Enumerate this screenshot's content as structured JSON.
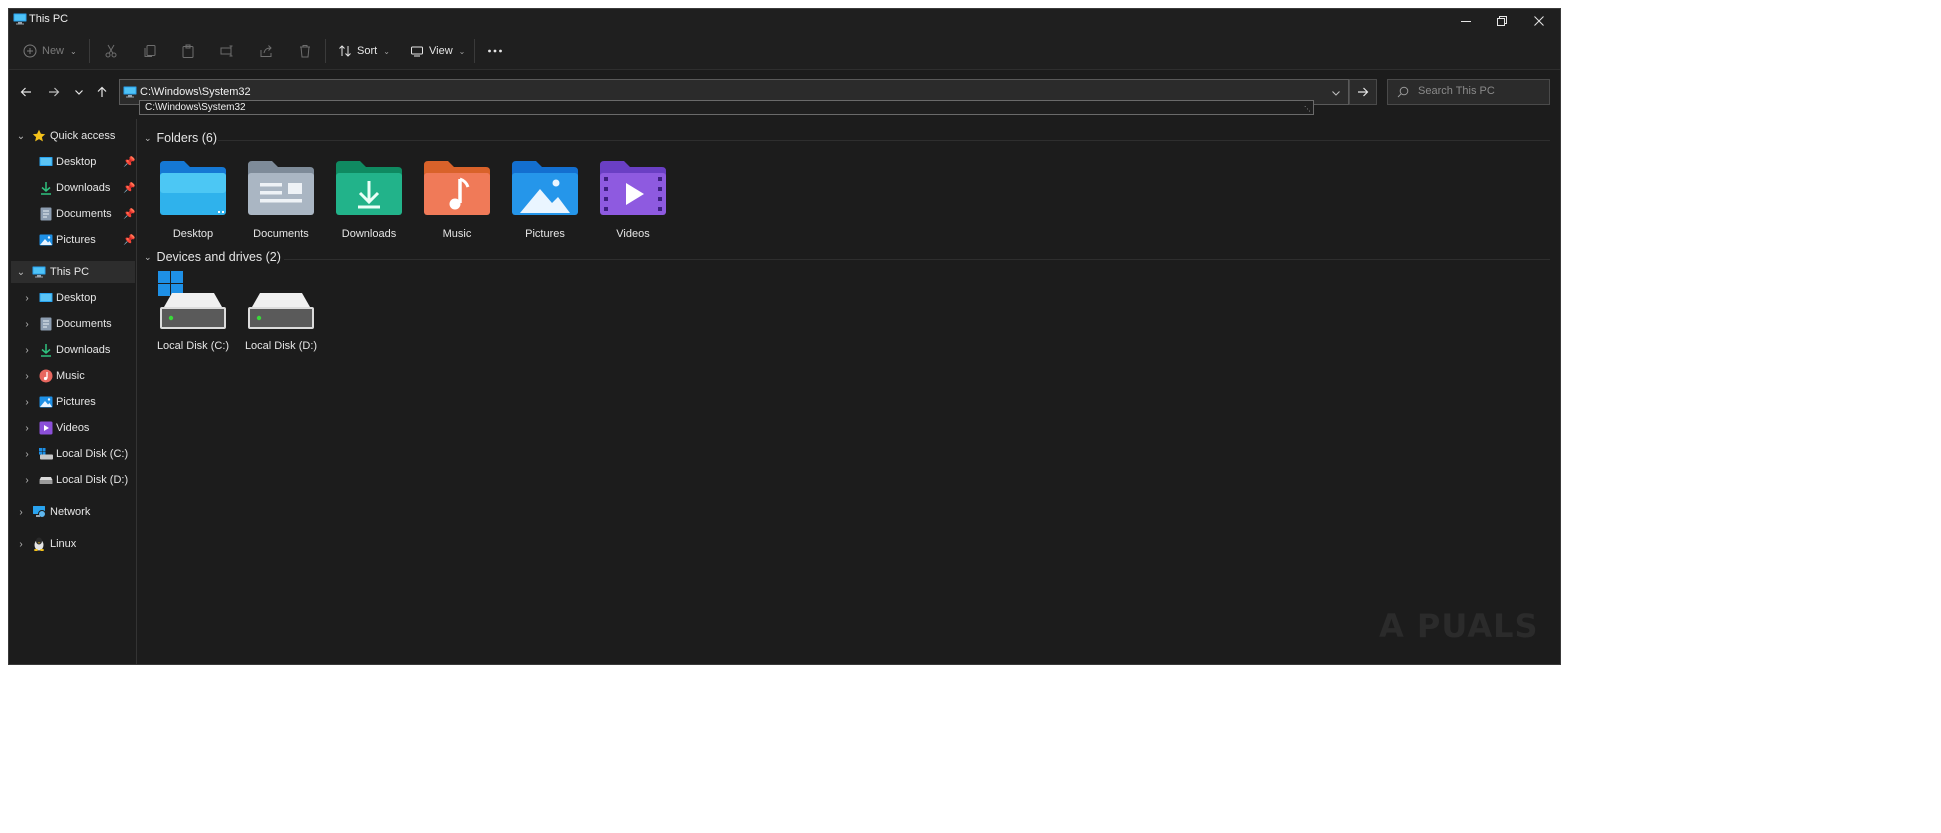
{
  "window": {
    "title": "This PC"
  },
  "titlebar": {
    "minimize_icon": "minimize-icon",
    "maximize_icon": "restore-icon",
    "close_icon": "close-icon"
  },
  "toolbar": {
    "new_label": "New",
    "sort_label": "Sort",
    "view_label": "View",
    "icons": [
      "cut-icon",
      "copy-icon",
      "paste-icon",
      "rename-icon",
      "share-icon",
      "delete-icon",
      "more-icon"
    ]
  },
  "address": {
    "path": "C:\\Windows\\System32",
    "suggestion": "C:\\Windows\\System32"
  },
  "search": {
    "placeholder": "Search This PC"
  },
  "sidebar": {
    "quick_access": {
      "label": "Quick access",
      "items": [
        {
          "label": "Desktop",
          "icon": "desktop-icon",
          "pinned": true
        },
        {
          "label": "Downloads",
          "icon": "download-icon",
          "pinned": true
        },
        {
          "label": "Documents",
          "icon": "document-icon",
          "pinned": true
        },
        {
          "label": "Pictures",
          "icon": "pictures-icon",
          "pinned": true
        }
      ]
    },
    "this_pc": {
      "label": "This PC",
      "items": [
        {
          "label": "Desktop",
          "icon": "desktop-icon"
        },
        {
          "label": "Documents",
          "icon": "document-icon"
        },
        {
          "label": "Downloads",
          "icon": "download-icon"
        },
        {
          "label": "Music",
          "icon": "music-icon"
        },
        {
          "label": "Pictures",
          "icon": "pictures-icon"
        },
        {
          "label": "Videos",
          "icon": "videos-icon"
        },
        {
          "label": "Local Disk (C:)",
          "icon": "system-drive-icon"
        },
        {
          "label": "Local Disk (D:)",
          "icon": "drive-icon"
        }
      ]
    },
    "network": {
      "label": "Network"
    },
    "linux": {
      "label": "Linux"
    }
  },
  "main": {
    "folders_header": "Folders (6)",
    "folders": [
      {
        "label": "Desktop",
        "icon": "desktop-folder-icon"
      },
      {
        "label": "Documents",
        "icon": "documents-folder-icon"
      },
      {
        "label": "Downloads",
        "icon": "downloads-folder-icon"
      },
      {
        "label": "Music",
        "icon": "music-folder-icon"
      },
      {
        "label": "Pictures",
        "icon": "pictures-folder-icon"
      },
      {
        "label": "Videos",
        "icon": "videos-folder-icon"
      }
    ],
    "drives_header": "Devices and drives (2)",
    "drives": [
      {
        "label": "Local Disk (C:)",
        "icon": "system-drive-icon"
      },
      {
        "label": "Local Disk (D:)",
        "icon": "drive-icon"
      }
    ]
  },
  "watermark": "A PUALS",
  "colors": {
    "background": "#1c1c1c",
    "accent": "#0f8de8",
    "text": "#e6e6e6",
    "star": "#f4c21b"
  }
}
